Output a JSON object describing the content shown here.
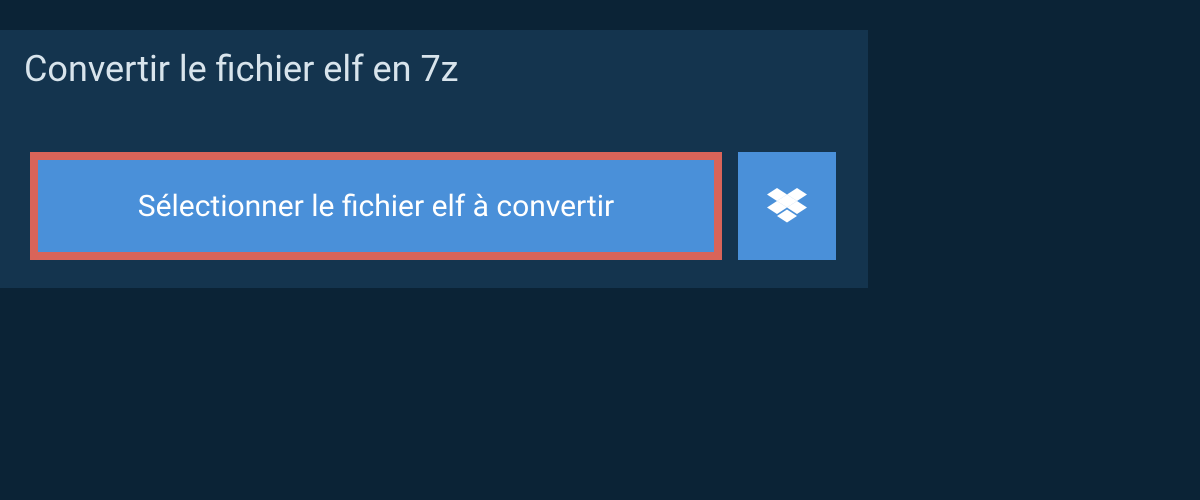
{
  "header": {
    "title": "Convertir le fichier elf en 7z"
  },
  "actions": {
    "select_label": "Sélectionner le fichier elf à convertir"
  },
  "colors": {
    "background": "#0b2336",
    "panel": "#14344e",
    "button": "#4a90d9",
    "highlight_border": "#d96459",
    "text_light": "#d8e4ec",
    "text_white": "#ffffff"
  }
}
